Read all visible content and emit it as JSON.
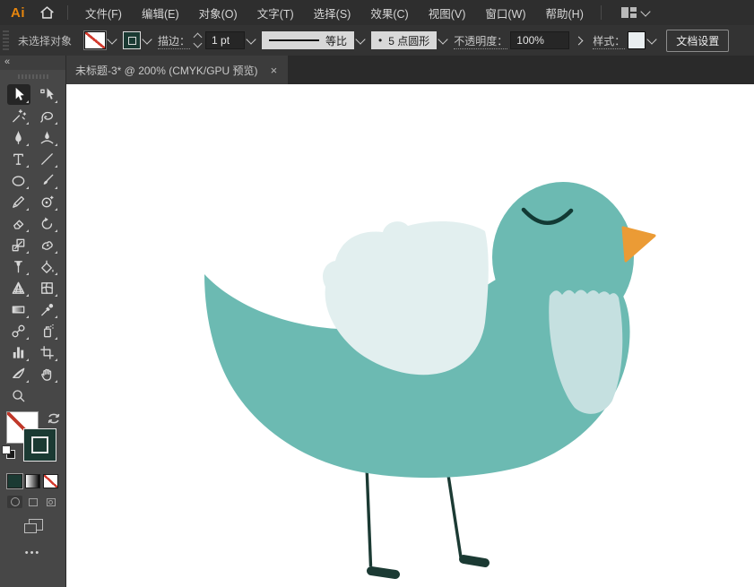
{
  "app": {
    "logo_text": "Ai"
  },
  "menu_bar": {
    "items": [
      {
        "id": "file",
        "label": "文件(F)"
      },
      {
        "id": "edit",
        "label": "编辑(E)"
      },
      {
        "id": "object",
        "label": "对象(O)"
      },
      {
        "id": "type",
        "label": "文字(T)"
      },
      {
        "id": "select",
        "label": "选择(S)"
      },
      {
        "id": "effect",
        "label": "效果(C)"
      },
      {
        "id": "view",
        "label": "视图(V)"
      },
      {
        "id": "window",
        "label": "窗口(W)"
      },
      {
        "id": "help",
        "label": "帮助(H)"
      }
    ]
  },
  "control_bar": {
    "status_text": "未选择对象",
    "stroke_label": "描边：",
    "stroke_weight": "1 pt",
    "stroke_profile": "等比",
    "brush_bullet": "•",
    "brush_name": "5 点圆形",
    "opacity_label": "不透明度：",
    "opacity_value": "100%",
    "style_label": "样式：",
    "document_setup_label": "文档设置"
  },
  "document_tab": {
    "title": "未标题-3* @ 200% (CMYK/GPU 预览)",
    "close_glyph": "×"
  },
  "tool_panel": {
    "collapse_glyph": "«",
    "more_glyph": "•••",
    "tools": [
      {
        "name": "selection-tool",
        "selected": true
      },
      {
        "name": "direct-selection-tool"
      },
      {
        "name": "magic-wand-tool"
      },
      {
        "name": "lasso-tool"
      },
      {
        "name": "pen-tool"
      },
      {
        "name": "curvature-tool"
      },
      {
        "name": "type-tool"
      },
      {
        "name": "line-segment-tool"
      },
      {
        "name": "ellipse-tool"
      },
      {
        "name": "paintbrush-tool"
      },
      {
        "name": "pencil-tool"
      },
      {
        "name": "shaper-tool"
      },
      {
        "name": "eraser-tool"
      },
      {
        "name": "rotate-tool"
      },
      {
        "name": "scale-tool"
      },
      {
        "name": "puppet-warp-tool"
      },
      {
        "name": "shape-builder-tool"
      },
      {
        "name": "live-paint-bucket-tool"
      },
      {
        "name": "perspective-grid-tool"
      },
      {
        "name": "mesh-tool"
      },
      {
        "name": "gradient-tool"
      },
      {
        "name": "eyedropper-tool"
      },
      {
        "name": "blend-tool"
      },
      {
        "name": "symbol-sprayer-tool"
      },
      {
        "name": "column-graph-tool"
      },
      {
        "name": "artboard-tool"
      },
      {
        "name": "slice-tool"
      },
      {
        "name": "hand-tool"
      },
      {
        "name": "zoom-tool",
        "noflyout": true
      }
    ]
  },
  "artwork": {
    "description": "Flat cartoon bird facing right: teal body and head, closed curved eye, orange triangular beak, pale blue wing and chest patch, two thin dark legs with dark rounded feet",
    "colors": {
      "body": "#6cbab2",
      "wing": "#e2efef",
      "chest": "#c5e0e0",
      "beak": "#eb9b35",
      "eye": "#123a34",
      "dark": "#1b3a33"
    }
  }
}
